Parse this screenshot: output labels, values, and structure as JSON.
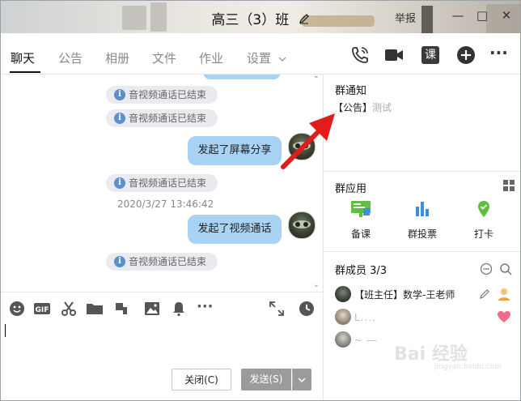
{
  "window": {
    "title": "高三（3）班",
    "report_label": "举报",
    "minimize": "—",
    "maximize": "□",
    "close": "✕"
  },
  "tabs": [
    {
      "label": "聊天",
      "active": true
    },
    {
      "label": "公告"
    },
    {
      "label": "相册"
    },
    {
      "label": "文件"
    },
    {
      "label": "作业"
    },
    {
      "label": "设置"
    }
  ],
  "tab_icons": {
    "call": "phone-icon",
    "video": "video-icon",
    "course": "课",
    "add": "plus-icon",
    "more": "···"
  },
  "chat": {
    "messages": [
      {
        "type": "system",
        "text": "音视频通话已结束"
      },
      {
        "type": "system",
        "text": "音视频通话已结束"
      },
      {
        "type": "bubble",
        "text": "发起了屏幕分享"
      },
      {
        "type": "system",
        "text": "音视频通话已结束"
      },
      {
        "type": "time",
        "text": "2020/3/27 13:46:42"
      },
      {
        "type": "bubble",
        "text": "发起了视频通话"
      },
      {
        "type": "system",
        "text": "音视频通话已结束"
      }
    ]
  },
  "composer": {
    "close_label": "关闭(C)",
    "send_label": "发送(S)"
  },
  "right_panel": {
    "notice_title": "群通知",
    "notice_tag": "【公告】",
    "notice_text": "测试",
    "apps_title": "群应用",
    "apps": [
      {
        "label": "备课",
        "color": "#5fbf3f"
      },
      {
        "label": "群投票",
        "color": "#3a8fe0"
      },
      {
        "label": "打卡",
        "color": "#5fbf3f"
      }
    ],
    "members_title": "群成员 3/3",
    "members": [
      {
        "name": "【班主任】数学-王老师"
      },
      {
        "name": "L...."
      },
      {
        "name": "~ —"
      }
    ]
  },
  "watermark": {
    "main": "Bai 经验",
    "sub": "jingyan.baidu.com"
  },
  "colors": {
    "bubble": "#a9d3f5",
    "system_pill": "#e9ebee",
    "info_icon": "#5a8fd0",
    "arrow": "#e21b1b",
    "send_button": "#9b9b9b"
  }
}
